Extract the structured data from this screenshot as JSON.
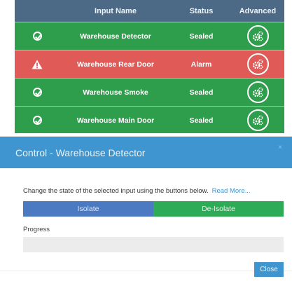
{
  "table": {
    "headers": {
      "name": "Input Name",
      "status": "Status",
      "advanced": "Advanced"
    },
    "rows": [
      {
        "name": "Warehouse Detector",
        "status": "Sealed",
        "state": "ok",
        "color": "#2f9e4c"
      },
      {
        "name": "Warehouse Rear Door",
        "status": "Alarm",
        "state": "alarm",
        "color": "#e05a57"
      },
      {
        "name": "Warehouse Smoke",
        "status": "Sealed",
        "state": "ok",
        "color": "#2f9e4c"
      },
      {
        "name": "Warehouse Main Door",
        "status": "Sealed",
        "state": "ok",
        "color": "#2f9e4c"
      }
    ]
  },
  "modal": {
    "title": "Control - Warehouse Detector",
    "close_x": "×",
    "description": "Change the state of the selected input using the buttons below.",
    "read_more": "Read More...",
    "isolate_label": "Isolate",
    "deisolate_label": "De-Isolate",
    "progress_label": "Progress",
    "progress_value": 0,
    "close_label": "Close"
  },
  "colors": {
    "header": "#4c6a86",
    "sealed_row": "#2f9e4c",
    "alarm_row": "#e05a57",
    "modal_header": "#3f95cf",
    "isolate": "#4b79c2",
    "deisolate": "#2eab57"
  },
  "icons": {
    "ok": "check-circle-icon",
    "alarm": "warning-triangle-icon",
    "advanced": "gears-icon",
    "close": "close-icon"
  }
}
